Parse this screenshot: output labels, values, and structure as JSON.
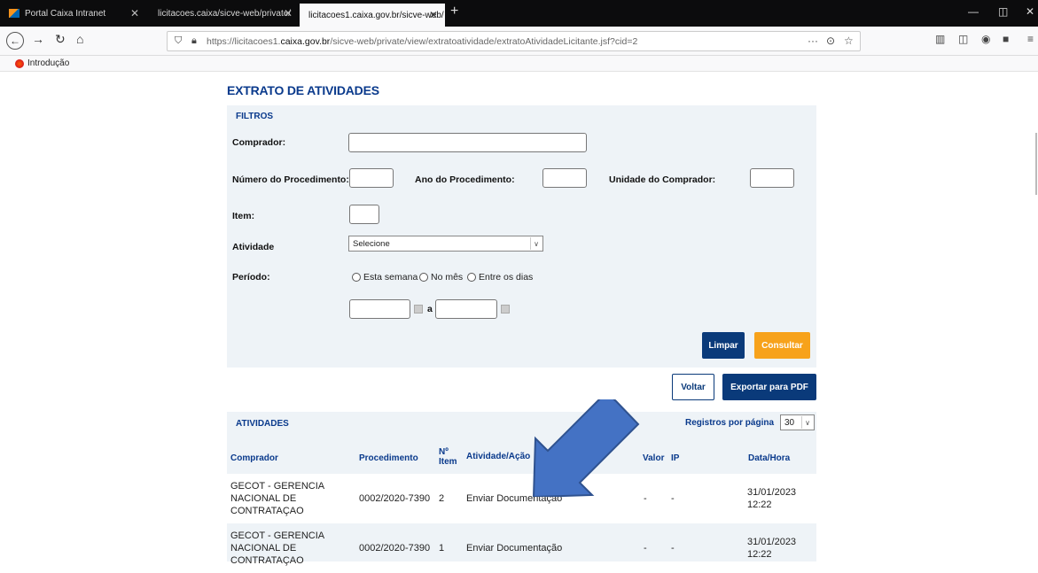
{
  "browser": {
    "tabs": [
      {
        "label": "Portal Caixa Intranet"
      },
      {
        "label": "licitacoes.caixa/sicve-web/private/"
      },
      {
        "label": "licitacoes1.caixa.gov.br/sicve-web/"
      }
    ],
    "url_prefix": "https://licitacoes1.",
    "url_domain": "caixa.gov.br",
    "url_suffix": "/sicve-web/private/view/extratoatividade/extratoAtividadeLicitante.jsf?cid=2",
    "bookmark": "Introdução"
  },
  "page": {
    "title": "EXTRATO DE ATIVIDADES",
    "filters": {
      "title": "FILTROS",
      "comprador_label": "Comprador:",
      "numero_label": "Número do Procedimento:",
      "ano_label": "Ano do Procedimento:",
      "unidade_label": "Unidade do Comprador:",
      "item_label": "Item:",
      "atividade_label": "Atividade",
      "atividade_value": "Selecione",
      "periodo_label": "Período:",
      "periodo_options": [
        "Esta semana",
        "No mês",
        "Entre os dias"
      ],
      "date_sep": "a",
      "limpar": "Limpar",
      "consultar": "Consultar"
    },
    "voltar": "Voltar",
    "exportar": "Exportar para PDF",
    "activities": {
      "title": "ATIVIDADES",
      "per_page_label": "Registros por página",
      "per_page_value": "30",
      "headers": {
        "comprador": "Comprador",
        "procedimento": "Procedimento",
        "item_n": "Nº",
        "item_t": "Item",
        "atividade": "Atividade/Ação",
        "valor": "Valor",
        "ip": "IP",
        "data": "Data/Hora"
      },
      "rows": [
        {
          "c1": "GECOT - GERENCIA",
          "c2": "NACIONAL DE",
          "c3": "CONTRATAÇAO",
          "proc": "0002/2020-7390",
          "item": "2",
          "acao": "Enviar Documentação",
          "valor": "-",
          "ip": "-",
          "d1": "31/01/2023",
          "d2": "12:22"
        },
        {
          "c1": "GECOT - GERENCIA",
          "c2": "NACIONAL DE",
          "c3": "CONTRATAÇAO",
          "proc": "0002/2020-7390",
          "item": "1",
          "acao": "Enviar Documentação",
          "valor": "-",
          "ip": "-",
          "d1": "31/01/2023",
          "d2": "12:22"
        }
      ]
    }
  },
  "colors": {
    "navy": "#0a3a7a",
    "orange": "#f7a21b",
    "arrow": "#4472c4"
  }
}
